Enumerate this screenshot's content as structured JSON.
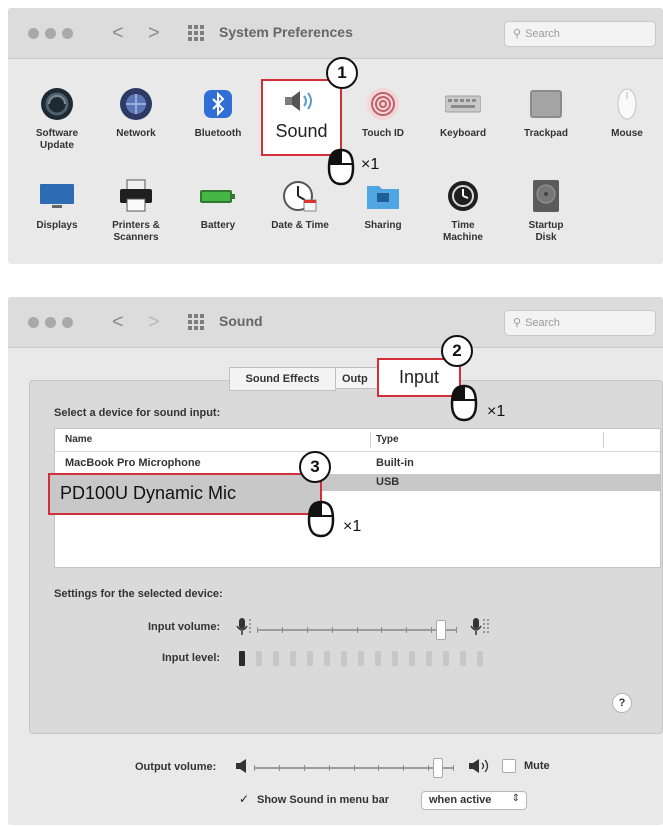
{
  "window1": {
    "title": "System Preferences",
    "search_placeholder": "Search",
    "nav_back": "<",
    "nav_forward": ">",
    "prefs_row1": [
      {
        "label": "Software\nUpdate",
        "icon": "software-update-icon"
      },
      {
        "label": "Network",
        "icon": "network-globe-icon"
      },
      {
        "label": "Bluetooth",
        "icon": "bluetooth-icon"
      },
      {
        "label": "Sound",
        "icon": "speaker-icon"
      },
      {
        "label": "Touch ID",
        "icon": "fingerprint-icon"
      },
      {
        "label": "Keyboard",
        "icon": "keyboard-icon"
      },
      {
        "label": "Trackpad",
        "icon": "trackpad-icon"
      },
      {
        "label": "Mouse",
        "icon": "mouse-device-icon"
      }
    ],
    "prefs_row2": [
      {
        "label": "Displays",
        "icon": "display-icon"
      },
      {
        "label": "Printers &\nScanners",
        "icon": "printer-icon"
      },
      {
        "label": "Battery",
        "icon": "battery-icon"
      },
      {
        "label": "Date & Time",
        "icon": "clock-calendar-icon"
      },
      {
        "label": "Sharing",
        "icon": "sharing-folder-icon"
      },
      {
        "label": "Time\nMachine",
        "icon": "time-machine-icon"
      },
      {
        "label": "Startup\nDisk",
        "icon": "startup-disk-icon"
      }
    ],
    "step_number": "1",
    "click_count": "×1"
  },
  "window2": {
    "title": "Sound",
    "search_placeholder": "Search",
    "nav_back": "<",
    "nav_forward": ">",
    "tabs": [
      "Sound Effects",
      "Outp",
      "Input"
    ],
    "section_label": "Select a device for sound input:",
    "columns": [
      "Name",
      "Type"
    ],
    "devices": [
      {
        "name": "MacBook Pro Microphone",
        "type": "Built-in"
      },
      {
        "name": "PD100U Dynamic Mic",
        "type": "USB"
      }
    ],
    "selected_device_index": 1,
    "settings_label": "Settings for the selected device:",
    "input_volume_label": "Input volume:",
    "input_volume_fraction": 0.92,
    "input_level_label": "Input level:",
    "input_level_active_bars": 1,
    "input_level_total_bars": 15,
    "help_button": "?",
    "output_volume_label": "Output volume:",
    "output_volume_fraction": 0.92,
    "mute_label": "Mute",
    "mute_checked": false,
    "show_sound_label": "Show Sound in menu bar",
    "show_sound_checked": true,
    "show_sound_check_glyph": "✓",
    "show_sound_option": "when active",
    "step2_number": "2",
    "step3_number": "3",
    "click_count": "×1"
  },
  "colors": {
    "highlight": "#d32f3a",
    "selected_row": "#c8c8c8"
  }
}
